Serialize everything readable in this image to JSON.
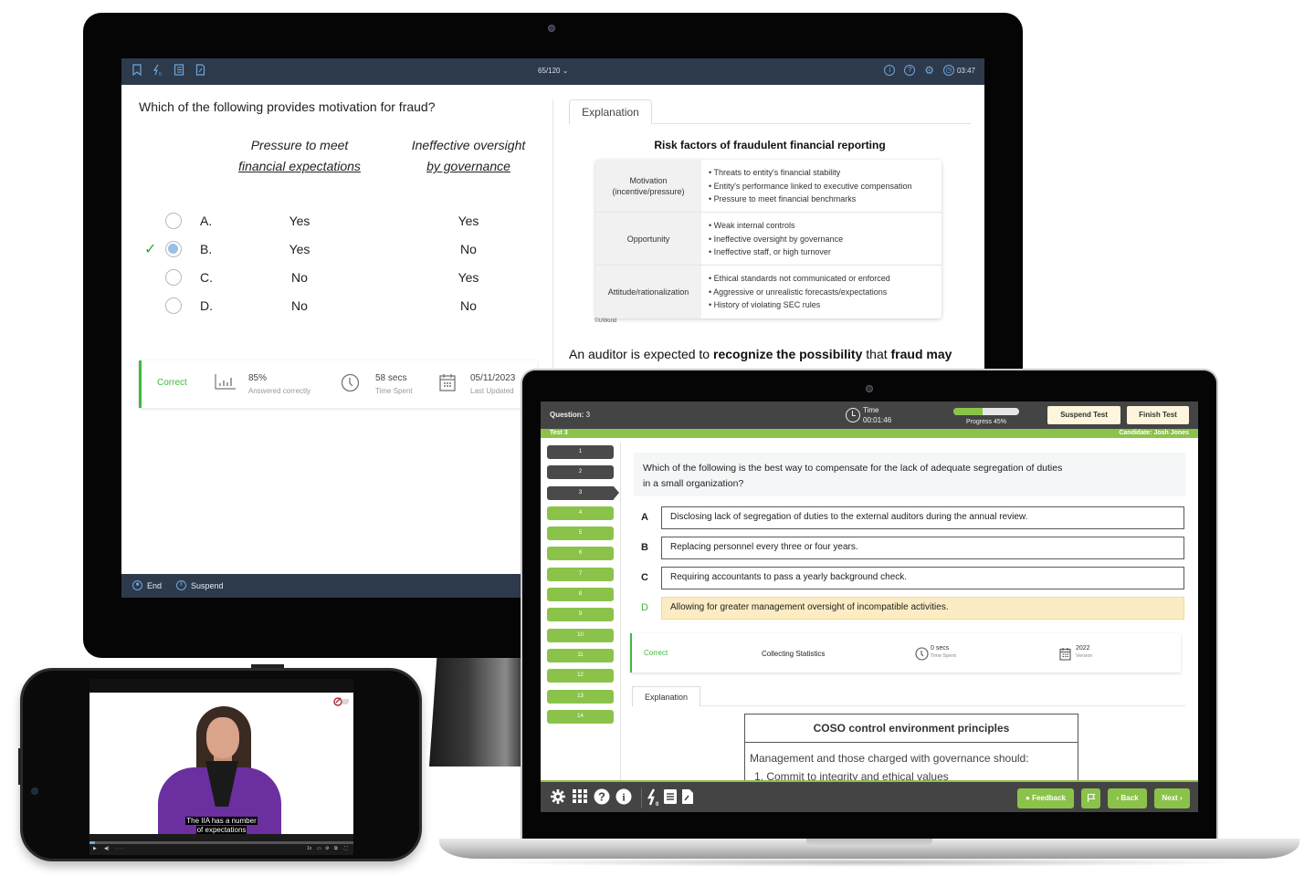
{
  "desktop_exam": {
    "topbar": {
      "left_icons": [
        "bookmark-icon",
        "flash-card-icon",
        "notebook-icon",
        "notes-icon"
      ],
      "question_counter": "65/120",
      "right_icons": [
        "info-icon",
        "help-icon",
        "settings-icon",
        "clock-icon"
      ],
      "timer": "03:47"
    },
    "question": "Which of the following provides motivation for fraud?",
    "columns": [
      {
        "line1": "Pressure to meet",
        "line2": "financial expectations"
      },
      {
        "line1": "Ineffective oversight",
        "line2": "by governance"
      }
    ],
    "options": [
      {
        "letter": "A.",
        "v1": "Yes",
        "v2": "Yes",
        "selected": false,
        "correct": false
      },
      {
        "letter": "B.",
        "v1": "Yes",
        "v2": "No",
        "selected": true,
        "correct": true
      },
      {
        "letter": "C.",
        "v1": "No",
        "v2": "Yes",
        "selected": false,
        "correct": false
      },
      {
        "letter": "D.",
        "v1": "No",
        "v2": "No",
        "selected": false,
        "correct": false
      }
    ],
    "stats": {
      "status": "Correct",
      "percent": "85%",
      "percent_label": "Answered correctly",
      "time": "58 secs",
      "time_label": "Time Spent",
      "date": "05/11/2023",
      "date_label": "Last Updated"
    },
    "explanation": {
      "tab": "Explanation",
      "table_title": "Risk factors of fraudulent financial reporting",
      "rows": [
        {
          "category_line1": "Motivation",
          "category_line2": "(incentive/pressure)",
          "items": [
            "Threats to entity's financial stability",
            "Entity's performance linked to executive compensation",
            "Pressure to meet financial benchmarks"
          ]
        },
        {
          "category_line1": "Opportunity",
          "category_line2": "",
          "items": [
            "Weak internal controls",
            "Ineffective oversight by governance",
            "Ineffective staff, or high turnover"
          ]
        },
        {
          "category_line1": "Attitude/rationalization",
          "category_line2": "",
          "items": [
            "Ethical standards not communicated or enforced",
            "Aggressive or unrealistic forecasts/expectations",
            "History of violating SEC rules"
          ]
        }
      ],
      "copyright": "©UWorld",
      "text_parts": [
        "An auditor is expected to ",
        "recognize the possibility",
        " that ",
        "fraud may"
      ]
    },
    "bottombar": {
      "end": "End",
      "suspend": "Suspend"
    }
  },
  "laptop_exam": {
    "header": {
      "question_label": "Question:",
      "question_number": "3",
      "time_label": "Time",
      "time_value": "00:01:46",
      "progress_percent": 45,
      "progress_label": "Progress 45%",
      "suspend_button": "Suspend Test",
      "finish_button": "Finish Test"
    },
    "subbar": {
      "test_name": "Test 3",
      "candidate": "Candidate: Josh Jones"
    },
    "nav_items": [
      {
        "label": "1",
        "state": "done"
      },
      {
        "label": "2",
        "state": "done"
      },
      {
        "label": "3",
        "state": "current"
      },
      {
        "label": "4",
        "state": "todo"
      },
      {
        "label": "5",
        "state": "todo"
      },
      {
        "label": "6",
        "state": "todo"
      },
      {
        "label": "7",
        "state": "todo"
      },
      {
        "label": "8",
        "state": "todo"
      },
      {
        "label": "9",
        "state": "todo"
      },
      {
        "label": "10",
        "state": "todo"
      },
      {
        "label": "11",
        "state": "todo"
      },
      {
        "label": "12",
        "state": "todo"
      },
      {
        "label": "13",
        "state": "todo"
      },
      {
        "label": "14",
        "state": "todo"
      }
    ],
    "question_line1": "Which of the following is the best way to compensate for the lack of adequate segregation of duties",
    "question_line2": "in a small organization?",
    "options": [
      {
        "letter": "A",
        "text": "Disclosing lack of segregation of duties to the external auditors during the annual review.",
        "correct": false
      },
      {
        "letter": "B",
        "text": "Replacing personnel every three or four years.",
        "correct": false
      },
      {
        "letter": "C",
        "text": "Requiring accountants to pass a yearly background check.",
        "correct": false
      },
      {
        "letter": "D",
        "text": "Allowing for greater management oversight of incompatible activities.",
        "correct": true
      }
    ],
    "stats": {
      "status": "Correct",
      "collecting": "Collecting Statistics",
      "time": "0 secs",
      "time_label": "Time Spent",
      "version": "2022",
      "version_label": "Version"
    },
    "explanation": {
      "tab": "Explanation",
      "box_title": "COSO control environment principles",
      "box_intro": "Management and those charged with governance should:",
      "box_item1": "1. Commit to integrity and ethical values"
    },
    "footer": {
      "left_icons": [
        "settings-icon",
        "grid-icon",
        "help-icon",
        "info-icon",
        "flash-card-icon",
        "notebook-icon",
        "notes-icon"
      ],
      "feedback": "Feedback",
      "back": "Back",
      "next": "Next"
    }
  },
  "phone_video": {
    "caption_line1": "The IIA has a number",
    "caption_line2": "of expectations",
    "progress_percent": 2
  }
}
